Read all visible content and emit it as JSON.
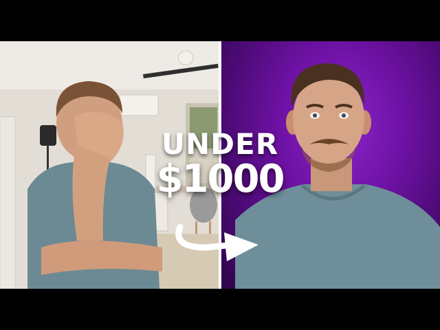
{
  "thumbnail": {
    "caption_line1": "UNDER",
    "caption_line2": "$1000"
  },
  "colors": {
    "right_background": "#6f12a6",
    "left_background": "#e4e0d8",
    "shirt": "#6b8a94",
    "caption_text": "#ffffff"
  }
}
